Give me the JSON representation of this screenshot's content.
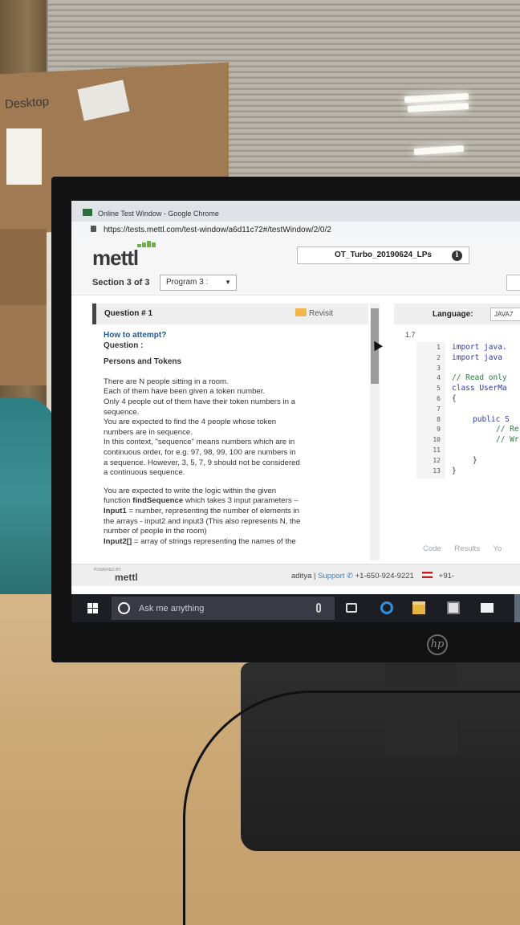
{
  "photo": {
    "box_text": "Desktop",
    "monitor_brand": "hp"
  },
  "browser": {
    "window_title": "Online Test Window - Google Chrome",
    "url": "https://tests.mettl.com/test-window/a6d11c72#/testWindow/2/0/2"
  },
  "header": {
    "logo": "mettl",
    "test_name": "OT_Turbo_20190624_LPs",
    "info_icon": "i",
    "section_label": "Section 3 of 3",
    "program_select": "Program 3 :",
    "brand_color": "#6bb43f"
  },
  "question": {
    "number_label": "Question # 1",
    "revisit_label": "Revisit",
    "how_to_attempt": "How to attempt?",
    "question_label": "Question :",
    "title": "Persons and Tokens",
    "p1": [
      "There are N people sitting in a room.",
      "Each of them have been given a token number.",
      "Only 4 people out of them have their token numbers in a",
      "sequence.",
      "You are expected to find the 4 people whose token",
      "numbers are in sequence.",
      "In this context, \"sequence\" means numbers which are in",
      "continuous order, for e.g. 97, 98, 99, 100 are numbers in",
      "a sequence. However, 3, 5, 7, 9 should not be considered",
      "a continuous sequence."
    ],
    "p2_line1": "You are expected to write the logic within the given",
    "p2_line2_prefix": "function ",
    "p2_function": "findSequence",
    "p2_line2_suffix": " which takes 3 input parameters –",
    "p2_input1": "Input1",
    "p2_input1_rest": " = number, representing the number of elements in",
    "p2_line4": "the arrays - input2 and input3 (This also represents N, the",
    "p2_line5": "number of people in the room)",
    "p2_input2": "Input2[]",
    "p2_input2_rest": " = array of strings representing the names of the"
  },
  "editor": {
    "language_label": "Language:",
    "language_value": "JAVA7",
    "version": "1.7",
    "line_numbers": [
      "1",
      "2",
      "3",
      "4",
      "5",
      "6",
      "7",
      "8",
      "9",
      "10",
      "11",
      "12",
      "13"
    ],
    "lines": [
      {
        "text": "import java.",
        "cls": "kw",
        "indent": 0
      },
      {
        "text": "import  java",
        "cls": "kw",
        "indent": 0
      },
      {
        "text": "",
        "cls": "pl",
        "indent": 0
      },
      {
        "text": "// Read only",
        "cls": "cm",
        "indent": 0
      },
      {
        "text": "class UserMa",
        "cls": "kw",
        "indent": 0
      },
      {
        "text": "{",
        "cls": "pl",
        "indent": 0
      },
      {
        "text": "",
        "cls": "pl",
        "indent": 0
      },
      {
        "text": "public S",
        "cls": "kw",
        "indent": 26
      },
      {
        "text": "// Re",
        "cls": "cm",
        "indent": 55
      },
      {
        "text": "// Wr",
        "cls": "cm",
        "indent": 55
      },
      {
        "text": "",
        "cls": "pl",
        "indent": 0
      },
      {
        "text": "}",
        "cls": "pl",
        "indent": 26
      },
      {
        "text": "}",
        "cls": "pl",
        "indent": 0
      }
    ],
    "tabs": [
      "Code",
      "Results",
      "Yo"
    ]
  },
  "footer": {
    "powered_by": "POWERED BY",
    "logo": "mettl",
    "user": "aditya",
    "separator": " | ",
    "support": "Support",
    "phone_icon": "✆",
    "phone": " +1-650-924-9221",
    "phone2": "+91-"
  },
  "taskbar": {
    "search_placeholder": "Ask me anything"
  }
}
